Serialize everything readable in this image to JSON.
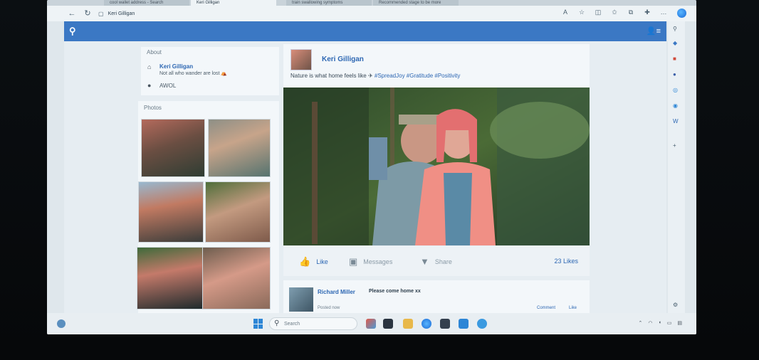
{
  "browser": {
    "tabs": [
      {
        "label": "cool wallet address - Search",
        "active": false
      },
      {
        "label": "Keri Gilligan",
        "active": true
      },
      {
        "label": "train swallowing symptoms",
        "active": false
      },
      {
        "label": "Recommended stage to be more",
        "active": false
      }
    ],
    "url": "Keri Gilligan",
    "back_icon": "back-arrow-icon",
    "refresh_icon": "refresh-icon"
  },
  "profile": {
    "about_title": "About",
    "name": "Keri Gilligan",
    "motto": "Not all who wander are lost ⛺",
    "location": "AWOL",
    "photos_title": "Photos"
  },
  "post": {
    "author": "Keri Gilligan",
    "text_prefix": "Nature is what home feels like ✈",
    "hashtags": "#SpreadJoy #Gratitude #Positivity",
    "like_label": "Like",
    "messages_label": "Messages",
    "share_label": "Share",
    "likes_count": "23 Likes"
  },
  "comment": {
    "author": "Richard Miller",
    "text": "Please come home xx",
    "time": "Posted now",
    "comment_label": "Comment",
    "like_label": "Like"
  },
  "taskbar": {
    "search_placeholder": "Search"
  },
  "colors": {
    "header_blue": "#3b78c4",
    "link_blue": "#2d67b3"
  }
}
